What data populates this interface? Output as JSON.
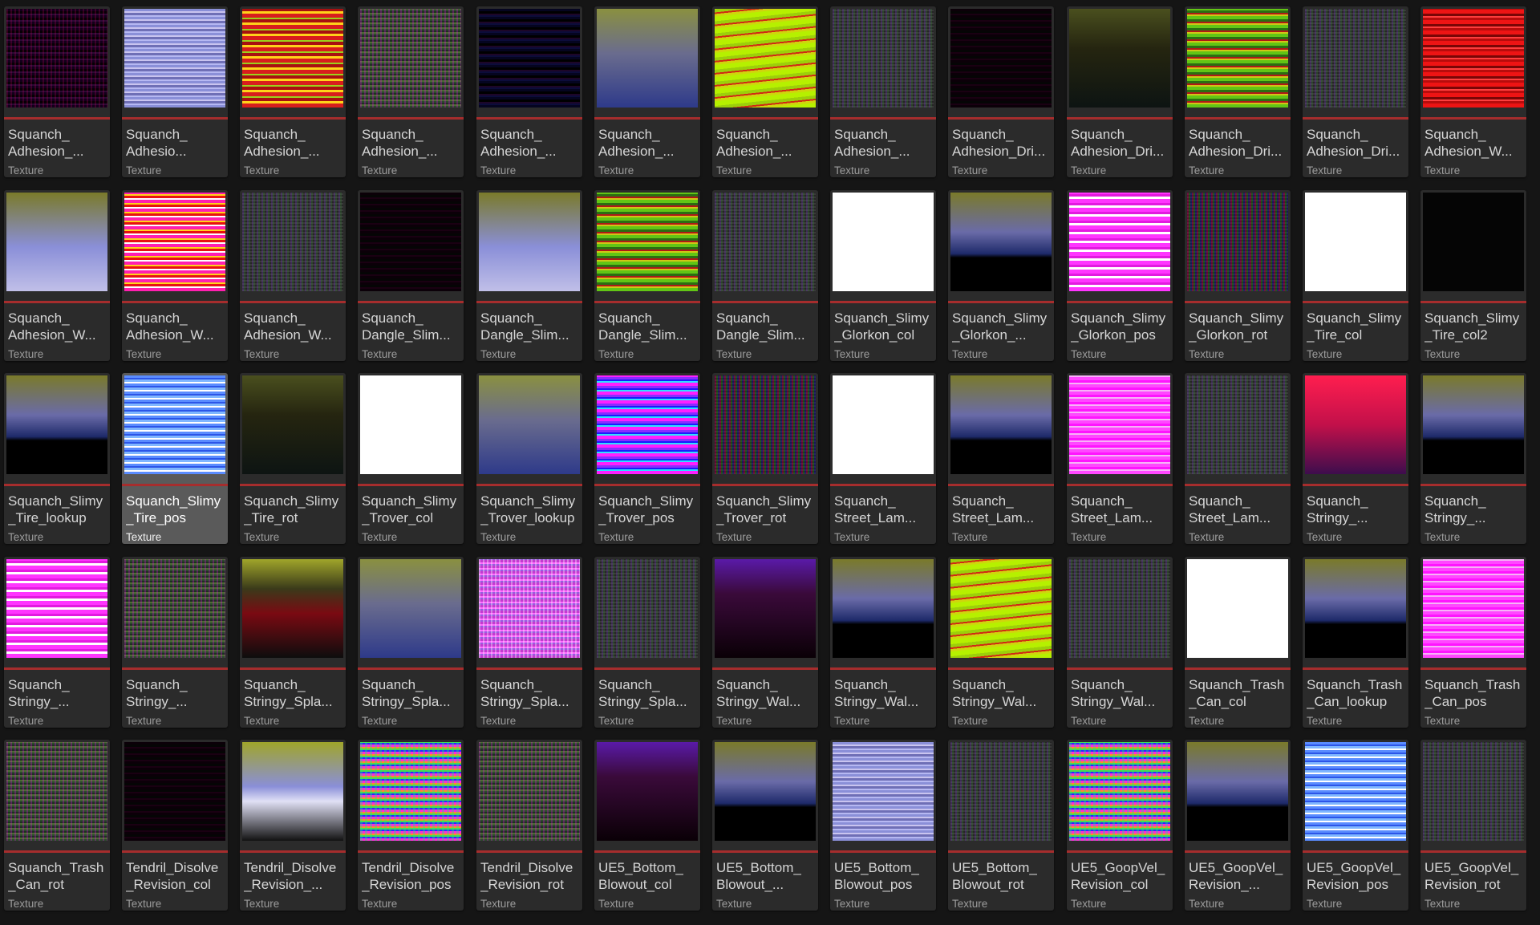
{
  "colors": {
    "background": "#151515",
    "tile": "#2b2b2b",
    "tile_selected": "#5a5a5a",
    "accent_bar": "#a62d2d",
    "text": "#d6d6d6",
    "type_text": "#9c9c9c"
  },
  "selected_index": 27,
  "assets": [
    {
      "name": "Squanch_\nAdhesion_...",
      "type": "Texture",
      "thumb": "noise-dark-purple"
    },
    {
      "name": "Squanch_\nAdhesio...",
      "type": "Texture",
      "thumb": "stripes-lavender"
    },
    {
      "name": "Squanch_\nAdhesion_...",
      "type": "Texture",
      "thumb": "stripes-red-yellow"
    },
    {
      "name": "Squanch_\nAdhesion_...",
      "type": "Texture",
      "thumb": "noise-green"
    },
    {
      "name": "Squanch_\nAdhesion_...",
      "type": "Texture",
      "thumb": "noise-dark-blue"
    },
    {
      "name": "Squanch_\nAdhesion_...",
      "type": "Texture",
      "thumb": "stripes-olive-blue"
    },
    {
      "name": "Squanch_\nAdhesion_...",
      "type": "Texture",
      "thumb": "stripes-lime"
    },
    {
      "name": "Squanch_\nAdhesion_...",
      "type": "Texture",
      "thumb": "noise-gray"
    },
    {
      "name": "Squanch_\nAdhesion_Dri...",
      "type": "Texture",
      "thumb": "noise-very-dark"
    },
    {
      "name": "Squanch_\nAdhesion_Dri...",
      "type": "Texture",
      "thumb": "stripes-dark-olive"
    },
    {
      "name": "Squanch_\nAdhesion_Dri...",
      "type": "Texture",
      "thumb": "stripes-green-red"
    },
    {
      "name": "Squanch_\nAdhesion_Dri...",
      "type": "Texture",
      "thumb": "noise-gray"
    },
    {
      "name": "Squanch_\nAdhesion_W...",
      "type": "Texture",
      "thumb": "stripes-red"
    },
    {
      "name": "Squanch_\nAdhesion_W...",
      "type": "Texture",
      "thumb": "stripes-olive-lavender"
    },
    {
      "name": "Squanch_\nAdhesion_W...",
      "type": "Texture",
      "thumb": "stripes-magenta-red"
    },
    {
      "name": "Squanch_\nAdhesion_W...",
      "type": "Texture",
      "thumb": "noise-gray"
    },
    {
      "name": "Squanch_\nDangle_Slim...",
      "type": "Texture",
      "thumb": "noise-very-dark"
    },
    {
      "name": "Squanch_\nDangle_Slim...",
      "type": "Texture",
      "thumb": "stripes-olive-lavender"
    },
    {
      "name": "Squanch_\nDangle_Slim...",
      "type": "Texture",
      "thumb": "stripes-green-red"
    },
    {
      "name": "Squanch_\nDangle_Slim...",
      "type": "Texture",
      "thumb": "noise-gray"
    },
    {
      "name": "Squanch_Slimy\n_Glorkon_col",
      "type": "Texture",
      "thumb": "white"
    },
    {
      "name": "Squanch_Slimy\n_Glorkon_...",
      "type": "Texture",
      "thumb": "stripes-olive-blue-black"
    },
    {
      "name": "Squanch_Slimy\n_Glorkon_pos",
      "type": "Texture",
      "thumb": "stripes-magenta-white"
    },
    {
      "name": "Squanch_Slimy\n_Glorkon_rot",
      "type": "Texture",
      "thumb": "noise-color"
    },
    {
      "name": "Squanch_Slimy\n_Tire_col",
      "type": "Texture",
      "thumb": "white"
    },
    {
      "name": "Squanch_Slimy\n_Tire_col2",
      "type": "Texture",
      "thumb": "black"
    },
    {
      "name": "Squanch_Slimy\n_Tire_lookup",
      "type": "Texture",
      "thumb": "stripes-olive-blue-black"
    },
    {
      "name": "Squanch_Slimy\n_Tire_pos",
      "type": "Texture",
      "thumb": "stripes-blue-white"
    },
    {
      "name": "Squanch_Slimy\n_Tire_rot",
      "type": "Texture",
      "thumb": "stripes-dark-olive"
    },
    {
      "name": "Squanch_Slimy\n_Trover_col",
      "type": "Texture",
      "thumb": "white"
    },
    {
      "name": "Squanch_Slimy\n_Trover_lookup",
      "type": "Texture",
      "thumb": "stripes-olive-blue"
    },
    {
      "name": "Squanch_Slimy\n_Trover_pos",
      "type": "Texture",
      "thumb": "stripes-magenta-cyan"
    },
    {
      "name": "Squanch_Slimy\n_Trover_rot",
      "type": "Texture",
      "thumb": "noise-color"
    },
    {
      "name": "Squanch_\nStreet_Lam...",
      "type": "Texture",
      "thumb": "white"
    },
    {
      "name": "Squanch_\nStreet_Lam...",
      "type": "Texture",
      "thumb": "stripes-olive-blue-black"
    },
    {
      "name": "Squanch_\nStreet_Lam...",
      "type": "Texture",
      "thumb": "stripes-magenta"
    },
    {
      "name": "Squanch_\nStreet_Lam...",
      "type": "Texture",
      "thumb": "noise-gray"
    },
    {
      "name": "Squanch_\nStringy_...",
      "type": "Texture",
      "thumb": "stripes-red-magenta"
    },
    {
      "name": "Squanch_\nStringy_...",
      "type": "Texture",
      "thumb": "stripes-olive-blue-black"
    },
    {
      "name": "Squanch_\nStringy_...",
      "type": "Texture",
      "thumb": "stripes-magenta-white"
    },
    {
      "name": "Squanch_\nStringy_...",
      "type": "Texture",
      "thumb": "noise-green"
    },
    {
      "name": "Squanch_\nStringy_Spla...",
      "type": "Texture",
      "thumb": "stripes-olive-red-black"
    },
    {
      "name": "Squanch_\nStringy_Spla...",
      "type": "Texture",
      "thumb": "stripes-olive-blue"
    },
    {
      "name": "Squanch_\nStringy_Spla...",
      "type": "Texture",
      "thumb": "noise-magenta"
    },
    {
      "name": "Squanch_\nStringy_Spla...",
      "type": "Texture",
      "thumb": "noise-gray"
    },
    {
      "name": "Squanch_\nStringy_Wal...",
      "type": "Texture",
      "thumb": "stripes-purple-dark"
    },
    {
      "name": "Squanch_\nStringy_Wal...",
      "type": "Texture",
      "thumb": "stripes-olive-blue-black"
    },
    {
      "name": "Squanch_\nStringy_Wal...",
      "type": "Texture",
      "thumb": "stripes-lime"
    },
    {
      "name": "Squanch_\nStringy_Wal...",
      "type": "Texture",
      "thumb": "noise-gray"
    },
    {
      "name": "Squanch_Trash\n_Can_col",
      "type": "Texture",
      "thumb": "white"
    },
    {
      "name": "Squanch_Trash\n_Can_lookup",
      "type": "Texture",
      "thumb": "stripes-olive-blue-black"
    },
    {
      "name": "Squanch_Trash\n_Can_pos",
      "type": "Texture",
      "thumb": "stripes-magenta"
    },
    {
      "name": "Squanch_Trash\n_Can_rot",
      "type": "Texture",
      "thumb": "noise-green"
    },
    {
      "name": "Tendril_Disolve\n_Revision_col",
      "type": "Texture",
      "thumb": "noise-very-dark"
    },
    {
      "name": "Tendril_Disolve\n_Revision_...",
      "type": "Texture",
      "thumb": "stripes-olive-white"
    },
    {
      "name": "Tendril_Disolve\n_Revision_pos",
      "type": "Texture",
      "thumb": "noise-magenta-green"
    },
    {
      "name": "Tendril_Disolve\n_Revision_rot",
      "type": "Texture",
      "thumb": "noise-green"
    },
    {
      "name": "UE5_Bottom_\nBlowout_col",
      "type": "Texture",
      "thumb": "stripes-purple-dark"
    },
    {
      "name": "UE5_Bottom_\nBlowout_...",
      "type": "Texture",
      "thumb": "stripes-olive-blue-black"
    },
    {
      "name": "UE5_Bottom_\nBlowout_pos",
      "type": "Texture",
      "thumb": "stripes-lavender"
    },
    {
      "name": "UE5_Bottom_\nBlowout_rot",
      "type": "Texture",
      "thumb": "noise-gray"
    },
    {
      "name": "UE5_GoopVel_\nRevision_col",
      "type": "Texture",
      "thumb": "noise-magenta-green"
    },
    {
      "name": "UE5_GoopVel_\nRevision_...",
      "type": "Texture",
      "thumb": "stripes-olive-blue-black"
    },
    {
      "name": "UE5_GoopVel_\nRevision_pos",
      "type": "Texture",
      "thumb": "stripes-blue-white"
    },
    {
      "name": "UE5_GoopVel_\nRevision_rot",
      "type": "Texture",
      "thumb": "noise-gray"
    }
  ]
}
